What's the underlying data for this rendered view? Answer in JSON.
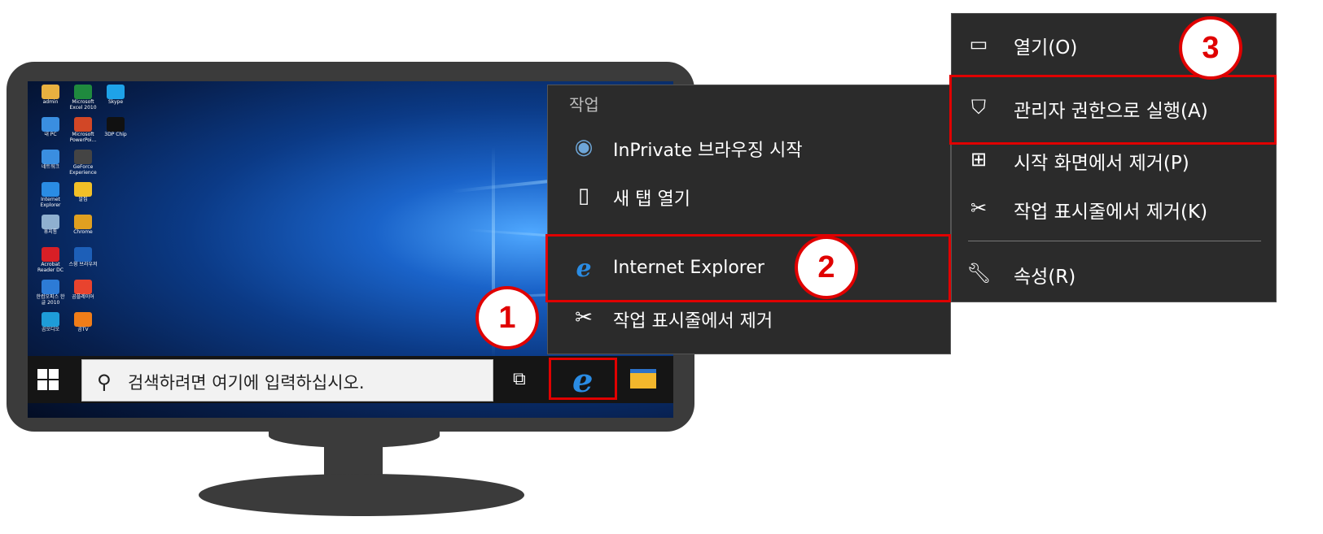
{
  "desktop": {
    "icons": [
      {
        "label": "admin",
        "color": "#e8b040"
      },
      {
        "label": "Microsoft Excel 2010",
        "color": "#1f8a3e"
      },
      {
        "label": "Skype",
        "color": "#1ea2e8"
      },
      {
        "label": "내 PC",
        "color": "#3a8ee0"
      },
      {
        "label": "Microsoft PowerPoi...",
        "color": "#d24726"
      },
      {
        "label": "3DP Chip",
        "color": "#111111"
      },
      {
        "label": "네트워크",
        "color": "#3a8ee0"
      },
      {
        "label": "GeForce Experience",
        "color": "#444444"
      },
      {
        "label": "Internet Explorer",
        "color": "#2a8ce4"
      },
      {
        "label": "알집",
        "color": "#f2c027"
      },
      {
        "label": "휴지통",
        "color": "#8fb0d0"
      },
      {
        "label": "Chrome",
        "color": "#e0a020"
      },
      {
        "label": "Acrobat Reader DC",
        "color": "#d71f26"
      },
      {
        "label": "스윙 브라우저",
        "color": "#1d5fb8"
      },
      {
        "label": "한컴오피스 한글 2010",
        "color": "#2d7bd6"
      },
      {
        "label": "곰플레이어",
        "color": "#e8432e"
      },
      {
        "label": "곰오디오",
        "color": "#1e9cd8"
      },
      {
        "label": "곰TV",
        "color": "#f07d18"
      }
    ],
    "skip_note": ""
  },
  "taskbar": {
    "search_placeholder": "검색하려면 여기에 입력하십시오.",
    "search_icon": "search-icon",
    "taskview_icon": "task-view-icon",
    "ie_icon": "internet-explorer-icon",
    "explorer_icon": "file-explorer-icon"
  },
  "jumplist": {
    "header": "작업",
    "items": [
      {
        "label": "InPrivate 브라우징 시작",
        "icon": "inprivate-icon"
      },
      {
        "label": "새 탭 열기",
        "icon": "new-tab-icon"
      },
      {
        "label": "Internet Explorer",
        "icon": "internet-explorer-icon"
      },
      {
        "label": "작업 표시줄에서 제거",
        "icon": "unpin-icon"
      }
    ]
  },
  "context_menu": {
    "items": [
      {
        "label": "열기(O)",
        "icon": "window-icon"
      },
      {
        "label": "관리자 권한으로 실행(A)",
        "icon": "shield-icon"
      },
      {
        "label": "시작 화면에서 제거(P)",
        "icon": "tiles-icon"
      },
      {
        "label": "작업 표시줄에서 제거(K)",
        "icon": "unpin-icon"
      },
      {
        "label": "속성(R)",
        "icon": "wrench-icon"
      }
    ]
  },
  "callouts": {
    "one": "1",
    "two": "2",
    "three": "3"
  },
  "colors": {
    "highlight": "#e00000",
    "menu_bg": "#2b2b2b",
    "ie_blue": "#2a8ce4"
  }
}
